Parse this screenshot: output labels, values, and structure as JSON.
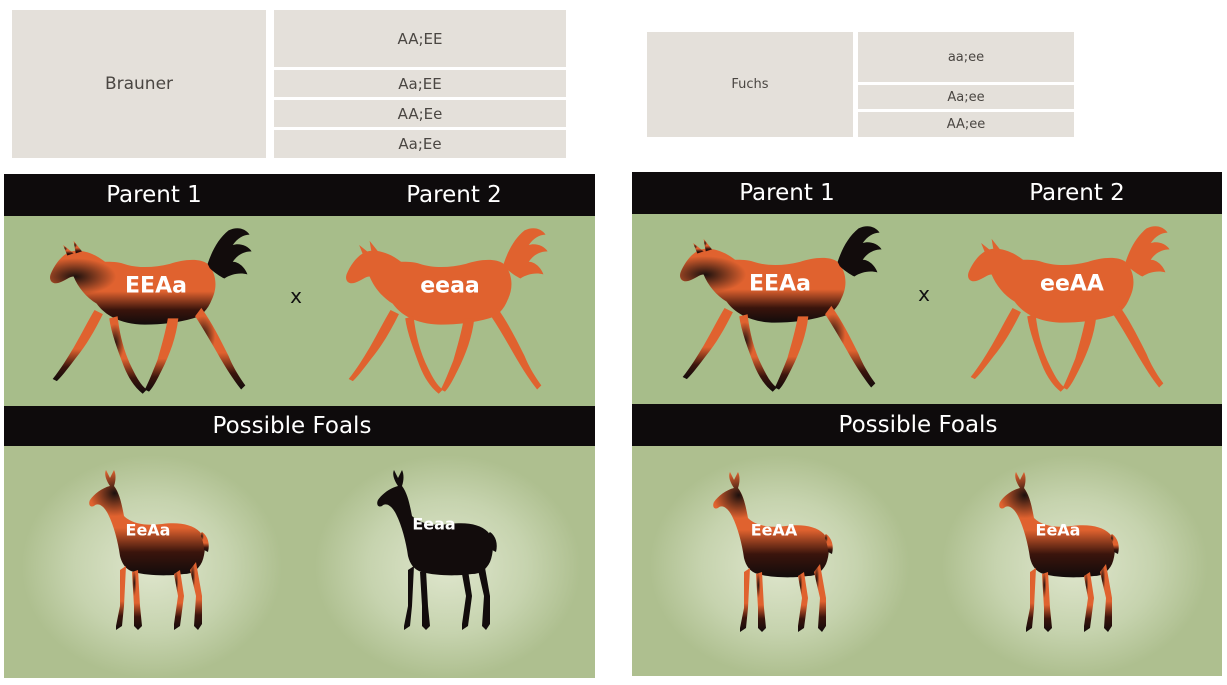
{
  "tables": {
    "left": {
      "name": "Brauner",
      "genotypes": [
        "AA;EE",
        "Aa;EE",
        "AA;Ee",
        "Aa;Ee"
      ]
    },
    "right": {
      "name": "Fuchs",
      "genotypes": [
        "aa;ee",
        "Aa;ee",
        "AA;ee"
      ]
    }
  },
  "panels": [
    {
      "parent1_heading": "Parent 1",
      "parent2_heading": "Parent 2",
      "parent1_genotype": "EEAa",
      "parent2_genotype": "eeaa",
      "cross_symbol": "x",
      "foals_heading": "Possible Foals",
      "foal1_genotype": "EeAa",
      "foal2_genotype": "Eeaa"
    },
    {
      "parent1_heading": "Parent 1",
      "parent2_heading": "Parent 2",
      "parent1_genotype": "EEAa",
      "parent2_genotype": "eeAA",
      "cross_symbol": "x",
      "foals_heading": "Possible Foals",
      "foal1_genotype": "EeAA",
      "foal2_genotype": "EeAa"
    }
  ],
  "colors": {
    "chestnut": "#e0622f",
    "black": "#120c0c",
    "header_bar": "#0e0b0c",
    "field_green": "#a7bd8a",
    "table_cell": "#e4e0da"
  }
}
